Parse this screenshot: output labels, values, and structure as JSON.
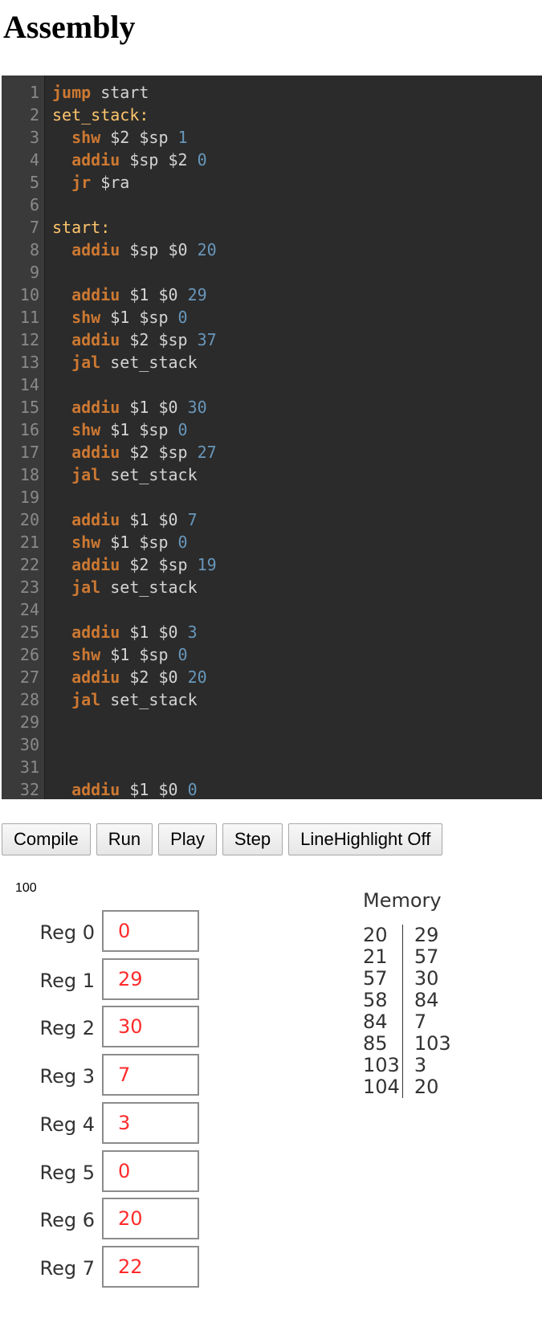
{
  "page": {
    "title": "Assembly"
  },
  "editor": {
    "lines": [
      {
        "n": "1",
        "tokens": [
          {
            "t": "kw",
            "v": "jump"
          },
          {
            "t": "text",
            "v": " start"
          }
        ]
      },
      {
        "n": "2",
        "tokens": [
          {
            "t": "label",
            "v": "set_stack:"
          }
        ]
      },
      {
        "n": "3",
        "tokens": [
          {
            "t": "text",
            "v": "  "
          },
          {
            "t": "kw",
            "v": "shw"
          },
          {
            "t": "text",
            "v": " $2 $sp "
          },
          {
            "t": "num",
            "v": "1"
          }
        ]
      },
      {
        "n": "4",
        "tokens": [
          {
            "t": "text",
            "v": "  "
          },
          {
            "t": "kw",
            "v": "addiu"
          },
          {
            "t": "text",
            "v": " $sp $2 "
          },
          {
            "t": "num",
            "v": "0"
          }
        ]
      },
      {
        "n": "5",
        "tokens": [
          {
            "t": "text",
            "v": "  "
          },
          {
            "t": "kw",
            "v": "jr"
          },
          {
            "t": "text",
            "v": " $ra"
          }
        ]
      },
      {
        "n": "6",
        "tokens": []
      },
      {
        "n": "7",
        "tokens": [
          {
            "t": "label",
            "v": "start:"
          }
        ]
      },
      {
        "n": "8",
        "tokens": [
          {
            "t": "text",
            "v": "  "
          },
          {
            "t": "kw",
            "v": "addiu"
          },
          {
            "t": "text",
            "v": " $sp $0 "
          },
          {
            "t": "num",
            "v": "20"
          }
        ]
      },
      {
        "n": "9",
        "tokens": []
      },
      {
        "n": "10",
        "tokens": [
          {
            "t": "text",
            "v": "  "
          },
          {
            "t": "kw",
            "v": "addiu"
          },
          {
            "t": "text",
            "v": " $1 $0 "
          },
          {
            "t": "num",
            "v": "29"
          }
        ]
      },
      {
        "n": "11",
        "tokens": [
          {
            "t": "text",
            "v": "  "
          },
          {
            "t": "kw",
            "v": "shw"
          },
          {
            "t": "text",
            "v": " $1 $sp "
          },
          {
            "t": "num",
            "v": "0"
          }
        ]
      },
      {
        "n": "12",
        "tokens": [
          {
            "t": "text",
            "v": "  "
          },
          {
            "t": "kw",
            "v": "addiu"
          },
          {
            "t": "text",
            "v": " $2 $sp "
          },
          {
            "t": "num",
            "v": "37"
          }
        ]
      },
      {
        "n": "13",
        "tokens": [
          {
            "t": "text",
            "v": "  "
          },
          {
            "t": "kw",
            "v": "jal"
          },
          {
            "t": "text",
            "v": " set_stack"
          }
        ]
      },
      {
        "n": "14",
        "tokens": []
      },
      {
        "n": "15",
        "tokens": [
          {
            "t": "text",
            "v": "  "
          },
          {
            "t": "kw",
            "v": "addiu"
          },
          {
            "t": "text",
            "v": " $1 $0 "
          },
          {
            "t": "num",
            "v": "30"
          }
        ]
      },
      {
        "n": "16",
        "tokens": [
          {
            "t": "text",
            "v": "  "
          },
          {
            "t": "kw",
            "v": "shw"
          },
          {
            "t": "text",
            "v": " $1 $sp "
          },
          {
            "t": "num",
            "v": "0"
          }
        ]
      },
      {
        "n": "17",
        "tokens": [
          {
            "t": "text",
            "v": "  "
          },
          {
            "t": "kw",
            "v": "addiu"
          },
          {
            "t": "text",
            "v": " $2 $sp "
          },
          {
            "t": "num",
            "v": "27"
          }
        ]
      },
      {
        "n": "18",
        "tokens": [
          {
            "t": "text",
            "v": "  "
          },
          {
            "t": "kw",
            "v": "jal"
          },
          {
            "t": "text",
            "v": " set_stack"
          }
        ]
      },
      {
        "n": "19",
        "tokens": []
      },
      {
        "n": "20",
        "tokens": [
          {
            "t": "text",
            "v": "  "
          },
          {
            "t": "kw",
            "v": "addiu"
          },
          {
            "t": "text",
            "v": " $1 $0 "
          },
          {
            "t": "num",
            "v": "7"
          }
        ]
      },
      {
        "n": "21",
        "tokens": [
          {
            "t": "text",
            "v": "  "
          },
          {
            "t": "kw",
            "v": "shw"
          },
          {
            "t": "text",
            "v": " $1 $sp "
          },
          {
            "t": "num",
            "v": "0"
          }
        ]
      },
      {
        "n": "22",
        "tokens": [
          {
            "t": "text",
            "v": "  "
          },
          {
            "t": "kw",
            "v": "addiu"
          },
          {
            "t": "text",
            "v": " $2 $sp "
          },
          {
            "t": "num",
            "v": "19"
          }
        ]
      },
      {
        "n": "23",
        "tokens": [
          {
            "t": "text",
            "v": "  "
          },
          {
            "t": "kw",
            "v": "jal"
          },
          {
            "t": "text",
            "v": " set_stack"
          }
        ]
      },
      {
        "n": "24",
        "tokens": []
      },
      {
        "n": "25",
        "tokens": [
          {
            "t": "text",
            "v": "  "
          },
          {
            "t": "kw",
            "v": "addiu"
          },
          {
            "t": "text",
            "v": " $1 $0 "
          },
          {
            "t": "num",
            "v": "3"
          }
        ]
      },
      {
        "n": "26",
        "tokens": [
          {
            "t": "text",
            "v": "  "
          },
          {
            "t": "kw",
            "v": "shw"
          },
          {
            "t": "text",
            "v": " $1 $sp "
          },
          {
            "t": "num",
            "v": "0"
          }
        ]
      },
      {
        "n": "27",
        "tokens": [
          {
            "t": "text",
            "v": "  "
          },
          {
            "t": "kw",
            "v": "addiu"
          },
          {
            "t": "text",
            "v": " $2 $0 "
          },
          {
            "t": "num",
            "v": "20"
          }
        ]
      },
      {
        "n": "28",
        "tokens": [
          {
            "t": "text",
            "v": "  "
          },
          {
            "t": "kw",
            "v": "jal"
          },
          {
            "t": "text",
            "v": " set_stack"
          }
        ]
      },
      {
        "n": "29",
        "tokens": []
      },
      {
        "n": "30",
        "tokens": []
      },
      {
        "n": "31",
        "tokens": []
      },
      {
        "n": "32",
        "tokens": [
          {
            "t": "text",
            "v": "  "
          },
          {
            "t": "kw",
            "v": "addiu"
          },
          {
            "t": "text",
            "v": " $1 $0 "
          },
          {
            "t": "num",
            "v": "0"
          }
        ]
      }
    ]
  },
  "toolbar": {
    "compile_label": "Compile",
    "run_label": "Run",
    "play_label": "Play",
    "step_label": "Step",
    "line_highlight_label": "LineHighlight Off"
  },
  "counter": "100",
  "registers": [
    {
      "label": "Reg 0",
      "value": "0"
    },
    {
      "label": "Reg 1",
      "value": "29"
    },
    {
      "label": "Reg 2",
      "value": "30"
    },
    {
      "label": "Reg 3",
      "value": "7"
    },
    {
      "label": "Reg 4",
      "value": "3"
    },
    {
      "label": "Reg 5",
      "value": "0"
    },
    {
      "label": "Reg 6",
      "value": "20"
    },
    {
      "label": "Reg 7",
      "value": "22"
    }
  ],
  "memory": {
    "title": "Memory",
    "rows": [
      {
        "addr": "20",
        "value": "29"
      },
      {
        "addr": "21",
        "value": "57"
      },
      {
        "addr": "57",
        "value": "30"
      },
      {
        "addr": "58",
        "value": "84"
      },
      {
        "addr": "84",
        "value": "7"
      },
      {
        "addr": "85",
        "value": "103"
      },
      {
        "addr": "103",
        "value": "3"
      },
      {
        "addr": "104",
        "value": "20"
      }
    ]
  },
  "colors": {
    "editor_background": "#2b2b2b",
    "keyword": "#cc7832",
    "label": "#ffc66d",
    "number": "#6897bb",
    "register_value": "#ff2b2b"
  }
}
